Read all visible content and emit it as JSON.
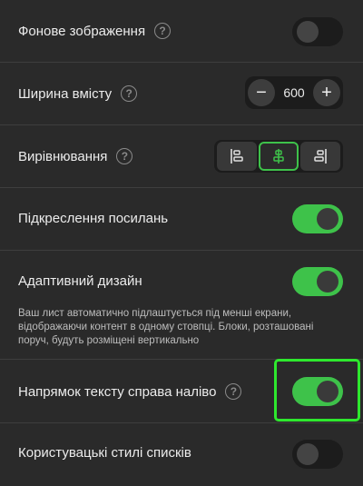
{
  "settings": {
    "background_image": {
      "label": "Фонове зображення",
      "enabled": false
    },
    "content_width": {
      "label": "Ширина вмісту",
      "value": "600",
      "minus": "−",
      "plus": "+"
    },
    "alignment": {
      "label": "Вирівнювання",
      "options": [
        "left-align-icon",
        "center-align-icon",
        "right-align-icon"
      ],
      "selected": "center"
    },
    "link_underline": {
      "label": "Підкреслення посилань",
      "enabled": true
    },
    "responsive": {
      "label": "Адаптивний дизайн",
      "enabled": true,
      "description": "Ваш лист автоматично підлаштується під менші екрани, відображаючи контент в одному стовпці. Блоки, розташовані поруч, будуть розміщені вертикально"
    },
    "rtl": {
      "label": "Напрямок тексту справа наліво",
      "enabled": true
    },
    "list_styles": {
      "label": "Користувацькі стилі списків",
      "enabled": false
    }
  },
  "help_glyph": "?",
  "colors": {
    "accent": "#3ec24a",
    "highlight": "#2ee82e",
    "background": "#2a2a2a"
  }
}
